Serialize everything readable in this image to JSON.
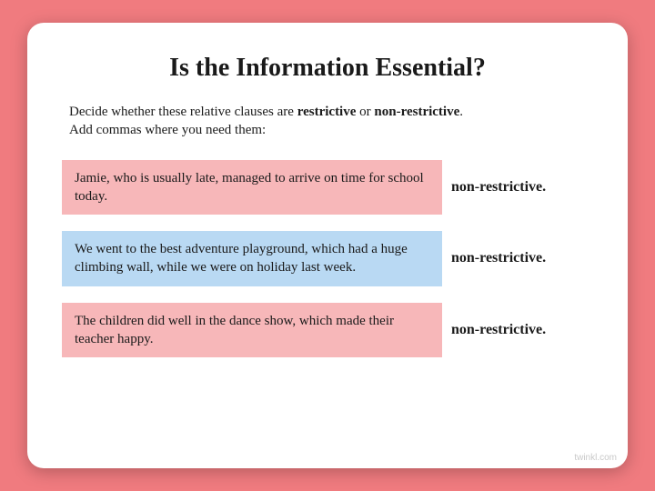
{
  "title": "Is the Information Essential?",
  "instructions": {
    "line1_pre": "Decide whether these relative clauses are ",
    "bold1": "restrictive",
    "mid": " or ",
    "bold2": "non-restrictive",
    "line1_post": ".",
    "line2": "Add commas where you need them:"
  },
  "rows": [
    {
      "sentence": "Jamie, who is usually late, managed to arrive on time for school today.",
      "answer": "non-restrictive."
    },
    {
      "sentence": "We went to the best adventure playground, which had a huge climbing wall, while we were on holiday last week.",
      "answer": "non-restrictive."
    },
    {
      "sentence": "The children did well in the dance show, which made their teacher happy.",
      "answer": "non-restrictive."
    }
  ],
  "watermark": "twinkl.com"
}
